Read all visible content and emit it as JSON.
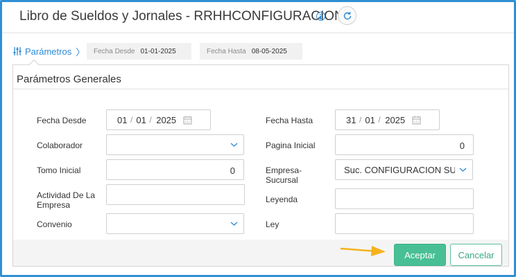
{
  "header": {
    "title": "Libro de Sueldos y Jornales - RRHHCONFIGURACION",
    "info_icon": "info-icon",
    "refresh_icon": "refresh-icon"
  },
  "tabs": {
    "active_label": "Parámetros",
    "chevron": "〉",
    "chips": [
      {
        "label": "Fecha Desde",
        "value": "01-01-2025"
      },
      {
        "label": "Fecha Hasta",
        "value": "08-05-2025"
      }
    ]
  },
  "panel": {
    "title": "Parámetros Generales",
    "fields": {
      "fecha_desde": {
        "label": "Fecha Desde",
        "day": "01",
        "month": "01",
        "year": "2025"
      },
      "colaborador": {
        "label": "Colaborador",
        "value": ""
      },
      "tomo_inicial": {
        "label": "Tomo Inicial",
        "value": "0"
      },
      "actividad": {
        "label_line1": "Actividad De La",
        "label_line2": "Empresa",
        "value": ""
      },
      "convenio": {
        "label": "Convenio",
        "value": ""
      },
      "fecha_hasta": {
        "label": "Fecha Hasta",
        "day": "31",
        "month": "01",
        "year": "2025"
      },
      "pagina_inicial": {
        "label": "Pagina Inicial",
        "value": "0"
      },
      "empresa_sucursal": {
        "label_line1": "Empresa-",
        "label_line2": "Sucursal",
        "value": "Suc. CONFIGURACION SU"
      },
      "leyenda": {
        "label": "Leyenda",
        "value": ""
      },
      "ley": {
        "label": "Ley",
        "value": ""
      }
    },
    "date_separator": "/"
  },
  "footer": {
    "accept_label": "Aceptar",
    "cancel_label": "Cancelar"
  },
  "colors": {
    "accent_blue": "#2a8ad8",
    "accept_green": "#48bf94",
    "annotation_arrow": "#f5b21b"
  }
}
